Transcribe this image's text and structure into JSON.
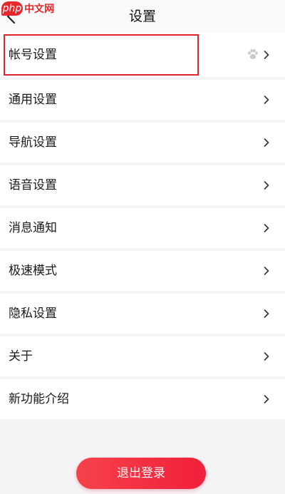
{
  "watermark": {
    "badge": "php",
    "site": "中文网"
  },
  "header": {
    "title": "设置"
  },
  "settings": {
    "items": [
      {
        "label": "帐号设置"
      },
      {
        "label": "通用设置"
      },
      {
        "label": "导航设置"
      },
      {
        "label": "语音设置"
      },
      {
        "label": "消息通知"
      },
      {
        "label": "极速模式"
      },
      {
        "label": "隐私设置"
      },
      {
        "label": "关于"
      },
      {
        "label": "新功能介绍"
      }
    ]
  },
  "logout": {
    "label": "退出登录"
  },
  "colors": {
    "accent": "#f0203a",
    "highlight_border": "#e0262c",
    "background": "#f4f4f6"
  }
}
